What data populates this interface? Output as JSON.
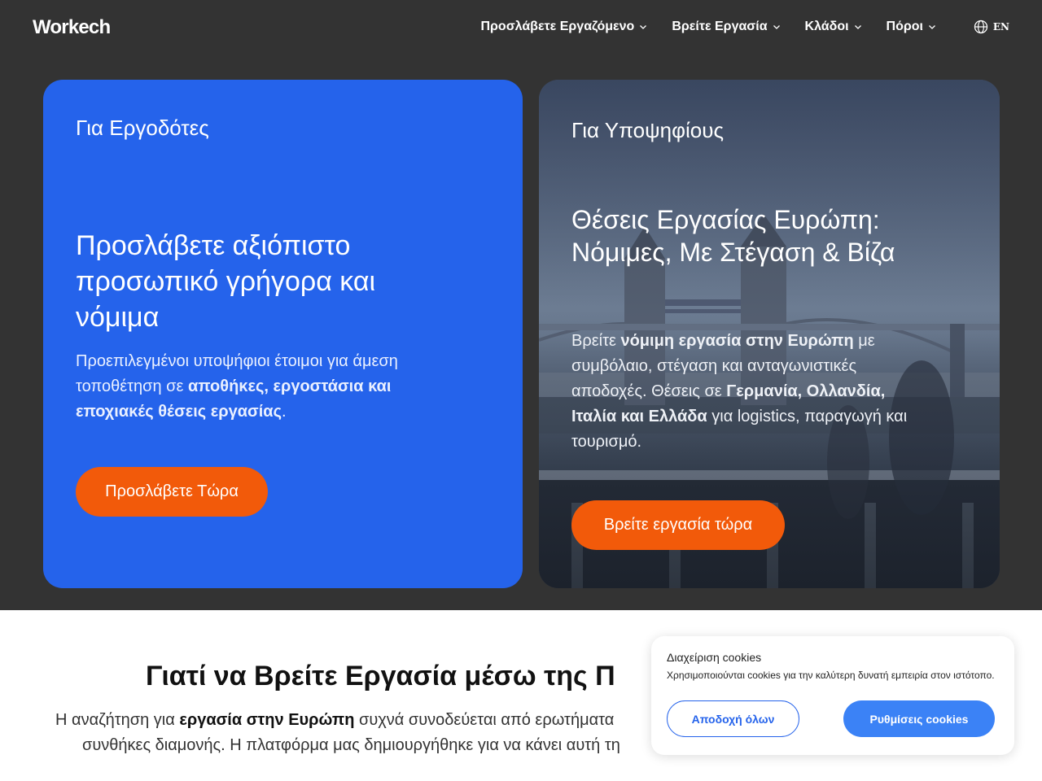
{
  "header": {
    "logo": "Workech",
    "nav": [
      {
        "label": "Προσλάβετε Εργαζόμενο"
      },
      {
        "label": "Βρείτε Εργασία"
      },
      {
        "label": "Κλάδοι"
      },
      {
        "label": "Πόροι"
      }
    ],
    "lang": "EN"
  },
  "employers": {
    "label": "Για Εργοδότες",
    "title": "Προσλάβετε αξιόπιστο προσωπικό γρήγορα και νόμιμα",
    "desc_pre": "Προεπιλεγμένοι υποψήφιοι έτοιμοι για άμεση τοποθέτηση σε ",
    "desc_bold": "αποθήκες, εργοστάσια και εποχιακές θέσεις εργασίας",
    "desc_post": ".",
    "cta": "Προσλάβετε Τώρα",
    "bg_color": "#2563eb"
  },
  "candidates": {
    "label": "Για Υποψηφίους",
    "title": "Θέσεις Εργασίας Ευρώπη: Νόμιμες, Με Στέγαση & Βίζα",
    "desc_1": "Βρείτε ",
    "desc_bold_1": "νόμιμη εργασία στην Ευρώπη",
    "desc_2": " με συμβόλαιο, στέγαση και ανταγωνιστικές αποδοχές. Θέσεις σε ",
    "desc_bold_2": "Γερμανία, Ολλανδία, Ιταλία και Ελλάδα",
    "desc_3": " για logistics, παραγωγή και τουρισμό.",
    "cta": "Βρείτε εργασία τώρα"
  },
  "why": {
    "title": "Γιατί να Βρείτε Εργασία μέσω της Π",
    "line1_pre": "Η αναζήτηση για ",
    "line1_bold": "εργασία στην Ευρώπη",
    "line1_post": " συχνά συνοδεύεται από ερωτήματα",
    "line2": "συνθήκες διαμονής. Η πλατφόρμα μας δημιουργήθηκε για να κάνει αυτή τη"
  },
  "cookie": {
    "title": "Διαχείριση cookies",
    "text": "Χρησιμοποιούνται cookies για την καλύτερη δυνατή εμπειρία στον ιστότοπο.",
    "accept": "Αποδοχή όλων",
    "settings": "Ρυθμίσεις cookies"
  },
  "colors": {
    "accent_orange": "#f25a0a",
    "hero_bg": "#333333",
    "primary_blue": "#2563eb"
  }
}
